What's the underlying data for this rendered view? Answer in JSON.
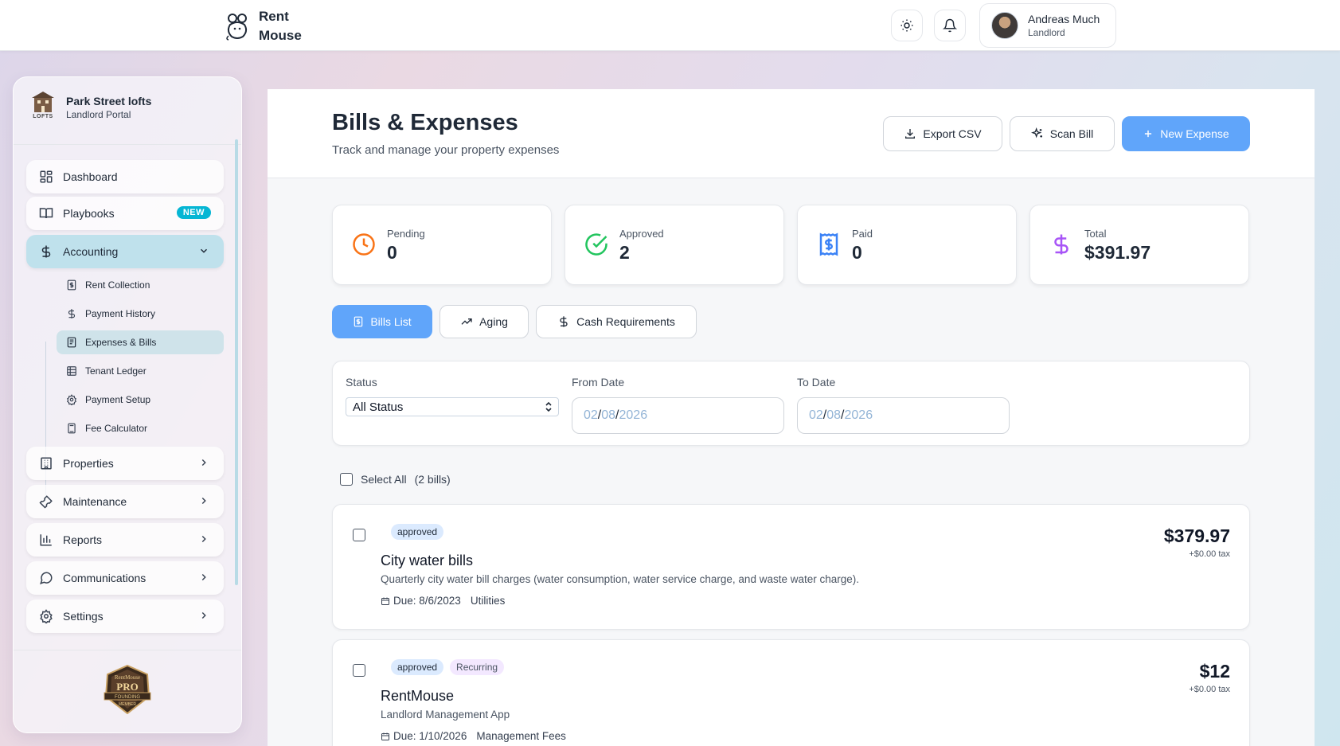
{
  "app": {
    "brand_line1": "Rent",
    "brand_line2": "Mouse"
  },
  "topbar": {
    "user_name": "Andreas Much",
    "user_role": "Landlord"
  },
  "sidebar": {
    "property_name": "Park Street lofts",
    "property_sub": "Landlord Portal",
    "property_logo_text": "LOFTS",
    "items": [
      {
        "label": "Dashboard",
        "icon": "dashboard-icon"
      },
      {
        "label": "Playbooks",
        "icon": "book-icon",
        "badge": "NEW"
      },
      {
        "label": "Accounting",
        "icon": "dollar-icon",
        "expanded": true
      },
      {
        "label": "Properties",
        "icon": "building-icon"
      },
      {
        "label": "Maintenance",
        "icon": "wrench-icon"
      },
      {
        "label": "Reports",
        "icon": "bar-chart-icon"
      },
      {
        "label": "Communications",
        "icon": "message-icon"
      },
      {
        "label": "Settings",
        "icon": "gear-icon"
      }
    ],
    "sub_items": [
      {
        "label": "Rent Collection",
        "icon": "receipt-icon"
      },
      {
        "label": "Payment History",
        "icon": "dollar-icon"
      },
      {
        "label": "Expenses & Bills",
        "icon": "receipt-icon",
        "active": true
      },
      {
        "label": "Tenant Ledger",
        "icon": "table-icon"
      },
      {
        "label": "Payment Setup",
        "icon": "gear-icon"
      },
      {
        "label": "Fee Calculator",
        "icon": "calculator-icon"
      }
    ],
    "pro_badge": {
      "line1": "RentMouse",
      "line2": "PRO",
      "line3": "FOUNDING",
      "line4": "MEMBER"
    }
  },
  "page": {
    "title": "Bills & Expenses",
    "subtitle": "Track and manage your property expenses",
    "export_label": "Export CSV",
    "scan_label": "Scan Bill",
    "new_label": "New Expense"
  },
  "stats": [
    {
      "label": "Pending",
      "value": "0",
      "color": "#f97316"
    },
    {
      "label": "Approved",
      "value": "2",
      "color": "#22c55e"
    },
    {
      "label": "Paid",
      "value": "0",
      "color": "#3b82f6"
    },
    {
      "label": "Total",
      "value": "$391.97",
      "color": "#a855f7"
    }
  ],
  "tabs": [
    {
      "label": "Bills List",
      "active": true
    },
    {
      "label": "Aging"
    },
    {
      "label": "Cash Requirements"
    }
  ],
  "filters": {
    "status_label": "Status",
    "status_value": "All Status",
    "from_label": "From Date",
    "from_mm": "02",
    "from_dd": "08",
    "from_yyyy": "2026",
    "to_label": "To Date",
    "to_mm": "02",
    "to_dd": "08",
    "to_yyyy": "2026"
  },
  "list": {
    "select_all": "Select All",
    "count": "(2 bills)"
  },
  "bills": [
    {
      "status": "approved",
      "title": "City water bills",
      "description": "Quarterly city water bill charges (water consumption, water service charge, and waste water charge).",
      "due": "Due: 8/6/2023",
      "category": "Utilities",
      "amount": "$379.97",
      "tax": "+$0.00 tax"
    },
    {
      "status": "approved",
      "recurring": "Recurring",
      "title": "RentMouse",
      "description": "Landlord Management App",
      "due": "Due: 1/10/2026",
      "category": "Management Fees",
      "amount": "$12",
      "tax": "+$0.00 tax"
    }
  ],
  "colors": {
    "accent": "#60a5fa",
    "active_nav": "#bfe1ec",
    "new_badge": "#06b6d4"
  }
}
